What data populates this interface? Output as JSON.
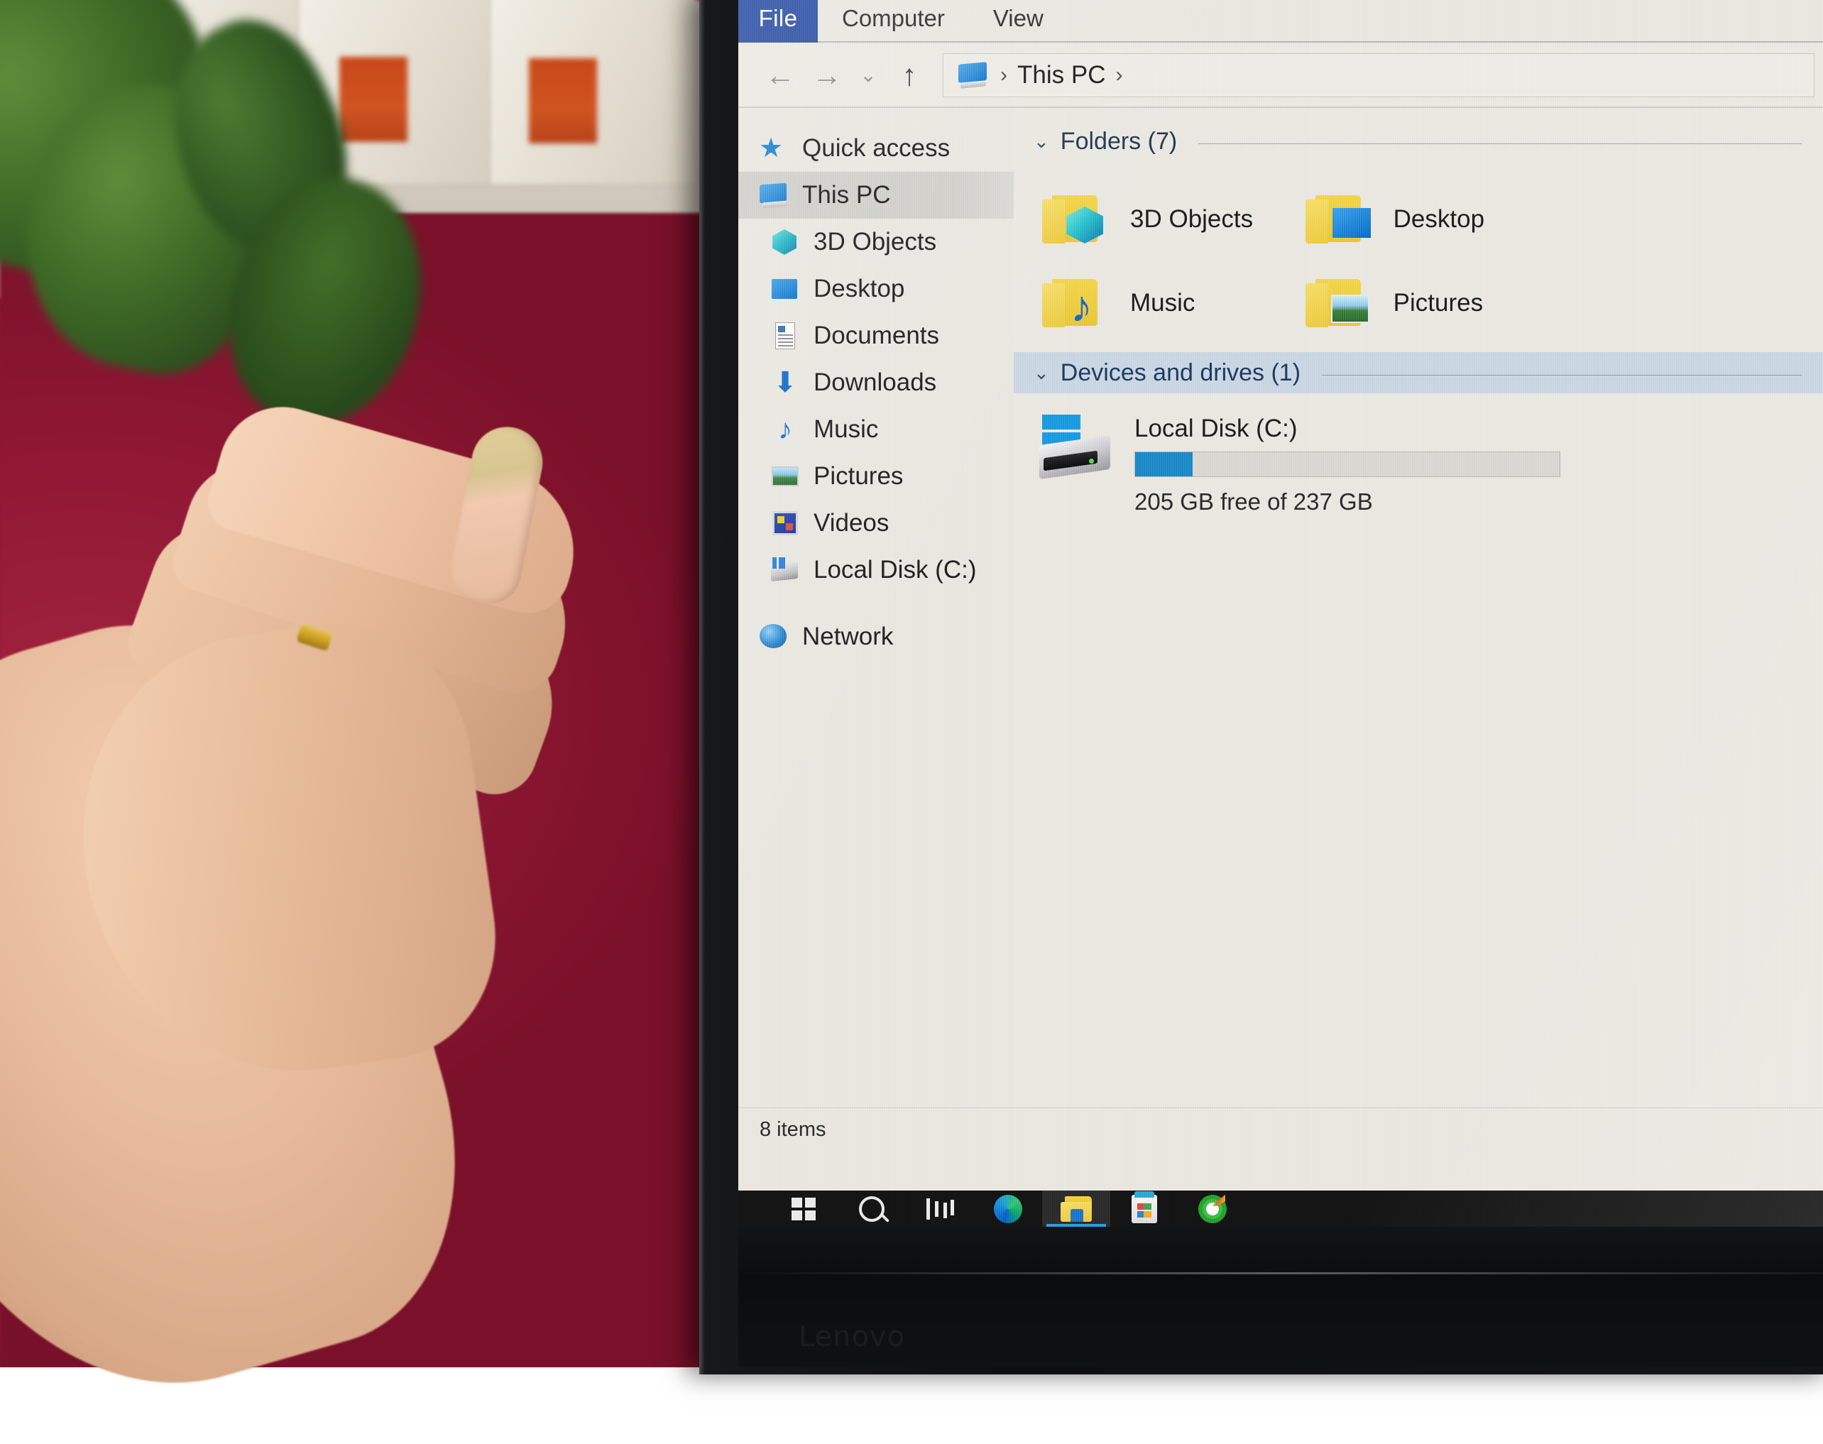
{
  "window": {
    "ribbon_tabs": [
      {
        "label": "File",
        "active": true
      },
      {
        "label": "Computer",
        "active": false
      },
      {
        "label": "View",
        "active": false
      }
    ],
    "nav_buttons": {
      "back": "←",
      "forward": "→",
      "recent": "⌄",
      "up": "↑"
    },
    "breadcrumb": {
      "icon": "this-pc-icon",
      "sep1": "›",
      "text": "This PC",
      "sep2": "›"
    },
    "statusbar": {
      "item_count": "8 items"
    }
  },
  "navpane": {
    "items": [
      {
        "label": "Quick access",
        "icon": "star-icon",
        "level": "root",
        "selected": false
      },
      {
        "label": "This PC",
        "icon": "this-pc-icon",
        "level": "root",
        "selected": true
      },
      {
        "label": "3D Objects",
        "icon": "cube-icon",
        "level": "child",
        "selected": false
      },
      {
        "label": "Desktop",
        "icon": "desktop-icon",
        "level": "child",
        "selected": false
      },
      {
        "label": "Documents",
        "icon": "document-icon",
        "level": "child",
        "selected": false
      },
      {
        "label": "Downloads",
        "icon": "download-icon",
        "level": "child",
        "selected": false
      },
      {
        "label": "Music",
        "icon": "music-note-icon",
        "level": "child",
        "selected": false
      },
      {
        "label": "Pictures",
        "icon": "picture-icon",
        "level": "child",
        "selected": false
      },
      {
        "label": "Videos",
        "icon": "video-icon",
        "level": "child",
        "selected": false
      },
      {
        "label": "Local Disk (C:)",
        "icon": "drive-icon",
        "level": "child",
        "selected": false
      },
      {
        "label": "Network",
        "icon": "network-icon",
        "level": "root",
        "selected": false
      }
    ]
  },
  "content": {
    "groups": [
      {
        "title": "Folders (7)",
        "chevron": "⌄",
        "highlighted": false,
        "items": [
          {
            "label": "3D Objects",
            "badge": "cube-badge"
          },
          {
            "label": "Desktop",
            "badge": "desktop-badge"
          },
          {
            "label": "Music",
            "badge": "music-badge"
          },
          {
            "label": "Pictures",
            "badge": "picture-badge"
          }
        ]
      },
      {
        "title": "Devices and drives (1)",
        "chevron": "⌄",
        "highlighted": true,
        "drives": [
          {
            "name": "Local Disk (C:)",
            "free_text": "205 GB free of 237 GB",
            "used_percent": 13.5,
            "bar_color": "#1e88c7"
          }
        ]
      }
    ]
  },
  "taskbar": {
    "items": [
      {
        "name": "start-button",
        "icon": "windows-icon",
        "active": false
      },
      {
        "name": "search-button",
        "icon": "search-icon",
        "active": false
      },
      {
        "name": "task-view-button",
        "icon": "task-view-icon",
        "active": false
      },
      {
        "name": "edge-button",
        "icon": "edge-icon",
        "active": false
      },
      {
        "name": "file-explorer-button",
        "icon": "file-explorer-icon",
        "active": true
      },
      {
        "name": "microsoft-store-button",
        "icon": "store-icon",
        "active": false
      },
      {
        "name": "disc-app-button",
        "icon": "disc-icon",
        "active": false
      }
    ]
  },
  "device": {
    "brand": "Lenovo"
  },
  "colors": {
    "file_tab_blue": "#2d4fa2",
    "group_highlight": "#c9d6e2",
    "selection_gray": "#cfcec9",
    "accent_blue": "#1e88c7",
    "window_bg": "#e8e6df",
    "taskbar_bg": "#141414"
  }
}
